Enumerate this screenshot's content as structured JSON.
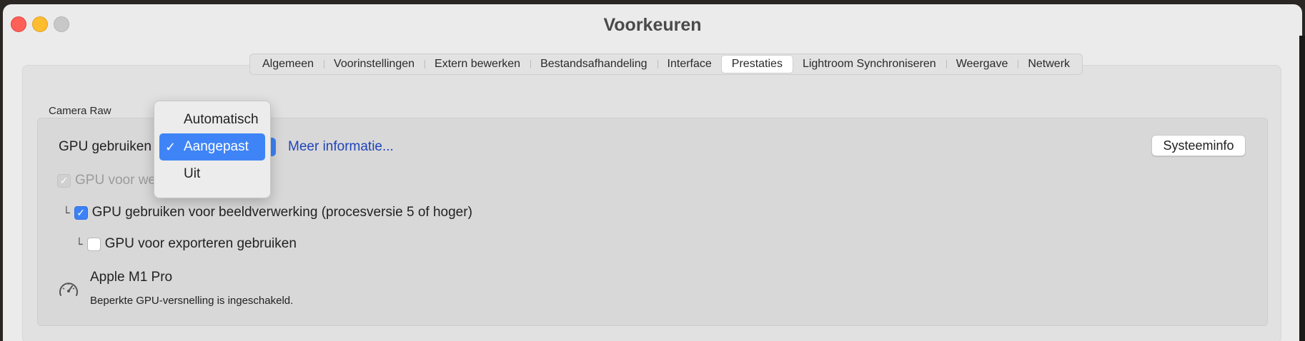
{
  "window": {
    "title": "Voorkeuren"
  },
  "tabs": [
    {
      "label": "Algemeen",
      "active": false
    },
    {
      "label": "Voorinstellingen",
      "active": false
    },
    {
      "label": "Extern bewerken",
      "active": false
    },
    {
      "label": "Bestandsafhandeling",
      "active": false
    },
    {
      "label": "Interface",
      "active": false
    },
    {
      "label": "Prestaties",
      "active": true
    },
    {
      "label": "Lightroom Synchroniseren",
      "active": false
    },
    {
      "label": "Weergave",
      "active": false
    },
    {
      "label": "Netwerk",
      "active": false
    }
  ],
  "camera_raw": {
    "section_label": "Camera Raw",
    "gpu_use_label": "GPU gebruiken :",
    "more_info_link": "Meer informatie...",
    "system_info_button": "Systeeminfo",
    "gpu_display_label": "GPU voor wee",
    "gpu_processing_label": "GPU gebruiken voor beeldverwerking (procesversie 5 of hoger)",
    "gpu_export_label": "GPU voor exporteren gebruiken",
    "check_mark": "✓",
    "tree_glyph": "└",
    "device_name": "Apple M1 Pro",
    "device_status": "Beperkte GPU-versnelling is ingeschakeld."
  },
  "dropdown": {
    "options": [
      {
        "label": "Automatisch",
        "selected": false
      },
      {
        "label": "Aangepast",
        "selected": true
      },
      {
        "label": "Uit",
        "selected": false
      }
    ],
    "check_mark": "✓"
  },
  "colors": {
    "accent": "#3c82f7",
    "link": "#1f44b8",
    "close": "#fe5f57",
    "minimize": "#febc2e"
  },
  "icons": [
    "speedometer-icon",
    "checkmark-icon"
  ]
}
